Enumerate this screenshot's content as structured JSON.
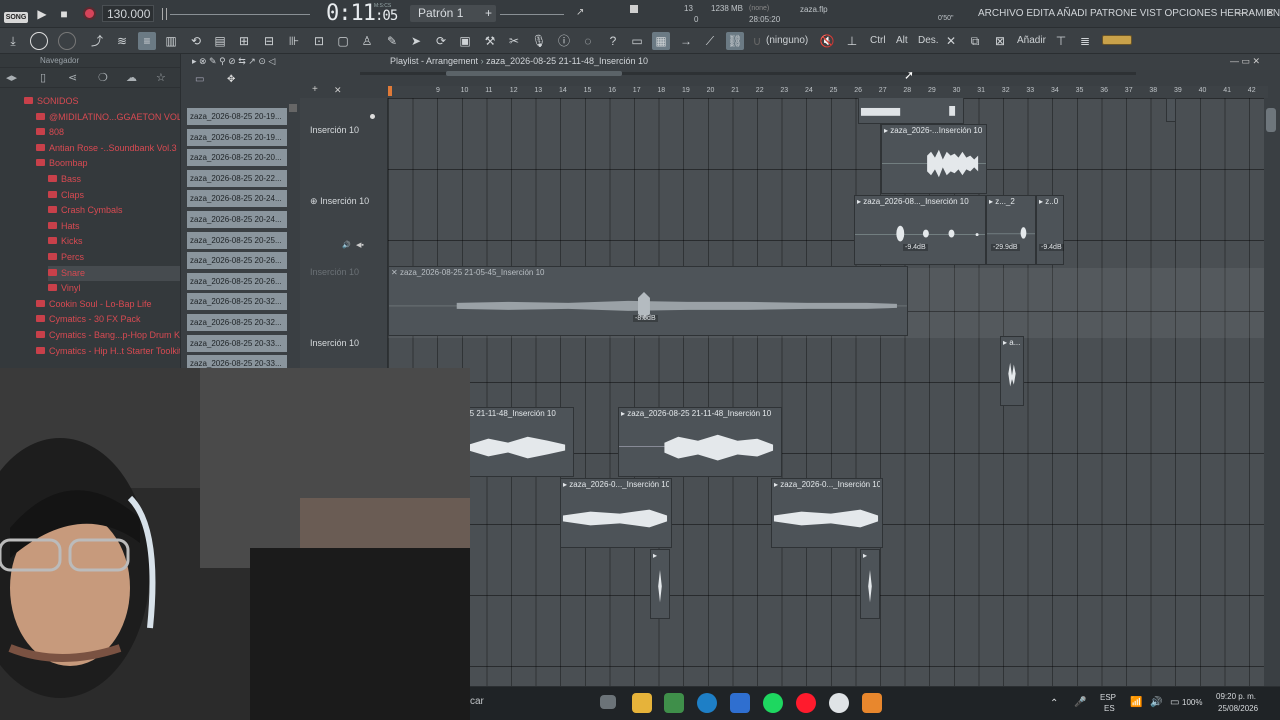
{
  "transport": {
    "mode_badge": "SONG",
    "tempo": "130.000",
    "time_main": "0:11",
    "time_sub": ":05",
    "time_units": "M:S:CS",
    "pattern": "Patrón 1",
    "cpu_count": "13",
    "voices": "0",
    "memory": "1238 MB",
    "clock_label": "(none)",
    "clock": "28:05:20",
    "filename": "zaza.flp",
    "latency": "0'50\""
  },
  "menu": {
    "items": "ARCHIVO EDITA AÑADI PATRONE VIST OPCIONES HERRAMIENTA AY"
  },
  "toolbar": {
    "snap_label": "(ninguno)",
    "ctrl": "Ctrl",
    "alt": "Alt",
    "des": "Des.",
    "add": "Añadir"
  },
  "browser": {
    "title": "Navegador",
    "items": [
      {
        "label": "SONIDOS",
        "level": 0
      },
      {
        "label": "@MIDILATINO...GGAETON VOL. 1",
        "level": 1
      },
      {
        "label": "808",
        "level": 1
      },
      {
        "label": "Antian Rose -..Soundbank Vol.3",
        "level": 1
      },
      {
        "label": "Boombap",
        "level": 1
      },
      {
        "label": "Bass",
        "level": 2
      },
      {
        "label": "Claps",
        "level": 2
      },
      {
        "label": "Crash Cymbals",
        "level": 2
      },
      {
        "label": "Hats",
        "level": 2
      },
      {
        "label": "Kicks",
        "level": 2
      },
      {
        "label": "Percs",
        "level": 2
      },
      {
        "label": "Snare",
        "level": 2
      },
      {
        "label": "Vinyl",
        "level": 2
      },
      {
        "label": "Cookin Soul - Lo-Bap Life",
        "level": 1
      },
      {
        "label": "Cymatics - 30 FX Pack",
        "level": 1
      },
      {
        "label": "Cymatics - Bang...p-Hop Drum Kit",
        "level": 1
      },
      {
        "label": "Cymatics - Hip H..t Starter Toolkit",
        "level": 1
      }
    ]
  },
  "picker": {
    "items": [
      "zaza_2026-08-25 20-19...",
      "zaza_2026-08-25 20-19...",
      "zaza_2026-08-25 20-20...",
      "zaza_2026-08-25 20-22...",
      "zaza_2026-08-25 20-24...",
      "zaza_2026-08-25 20-24...",
      "zaza_2026-08-25 20-25...",
      "zaza_2026-08-25 20-26...",
      "zaza_2026-08-25 20-26...",
      "zaza_2026-08-25 20-32...",
      "zaza_2026-08-25 20-32...",
      "zaza_2026-08-25 20-33...",
      "zaza_2026-08-25 20-33..."
    ]
  },
  "playlist": {
    "title": "Playlist - Arrangement",
    "pattern_crumb": "zaza_2026-08-25 21-11-48_Inserción 10",
    "ruler": [
      "9",
      "10",
      "11",
      "12",
      "13",
      "14",
      "15",
      "16",
      "17",
      "18",
      "19",
      "20",
      "21",
      "22",
      "23",
      "24",
      "25",
      "26",
      "27",
      "28",
      "29",
      "30",
      "31",
      "32",
      "33",
      "34",
      "35",
      "36",
      "37",
      "38",
      "39",
      "40",
      "41",
      "42"
    ],
    "track_names": [
      "Inserción 10",
      "Inserción 10",
      "Inserción 10",
      "Inserción 10"
    ],
    "clips": {
      "c1": "zaza_2026-...Inserción 10",
      "c2": "zaza_2026-08..._Inserción 10",
      "c2b": "z..._2",
      "c2c": "z..0",
      "c3": "zaza_2026-08-25 21-05-45_Inserción 10",
      "c4": "a...",
      "c5": "-08-25 21-11-48_Inserción 10",
      "c6": "zaza_2026-08-25 21-11-48_Inserción 10",
      "c7": "zaza_2026-0..._Inserción 10",
      "c8": "zaza_2026-0..._Inserción 10"
    },
    "db": {
      "a": "-9.4dB",
      "b": "-29.9dB",
      "c": "-9.4dB",
      "d": "-8.6dB"
    }
  },
  "taskbar": {
    "search_fragment": "car",
    "lang_top": "ESP",
    "lang_bottom": "ES",
    "battery": "100%",
    "time": "09:20 p. m.",
    "date": "25/08/2026"
  }
}
